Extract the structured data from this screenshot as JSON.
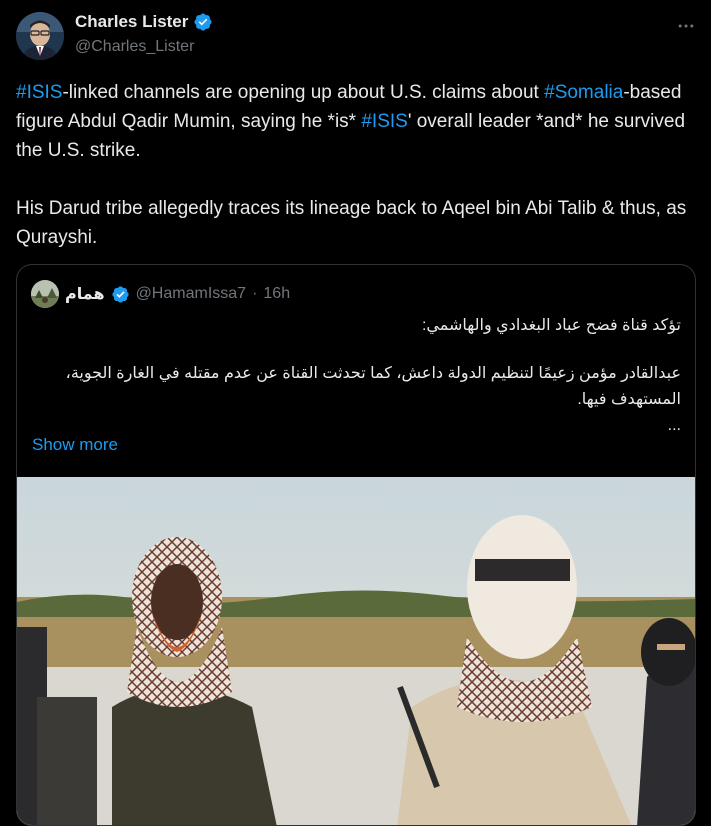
{
  "colors": {
    "background": "#000000",
    "text": "#e7e9ea",
    "muted": "#71767b",
    "link": "#1d9bf0",
    "verified": "#1d9bf0",
    "border": "#2f3336"
  },
  "author": {
    "name": "Charles Lister",
    "handle": "@Charles_Lister",
    "verified_icon": "verified-badge-icon"
  },
  "more_icon": "more-horizontal-icon",
  "tweet": {
    "p1": {
      "h1": "#ISIS",
      "t1": "-linked channels are opening up about U.S. claims about ",
      "h2": "#Somalia",
      "t2": "-based figure Abdul Qadir Mumin, saying he *is* ",
      "h3": "#ISIS",
      "t3": "' overall leader *and* he survived the U.S. strike."
    },
    "p2": "His Darud tribe allegedly traces its lineage back to Aqeel bin Abi Talib & thus, as Qurayshi."
  },
  "quote": {
    "name": "همام",
    "handle": "@HamamIssa7",
    "separator": "·",
    "time": "16h",
    "line1": "تؤكد قناة فضح عباد البغدادي والهاشمي:",
    "line2": "عبدالقادر مؤمن زعيمًا لتنظيم الدولة داعش، كما تحدثت القناة عن عدم مقتله في الغارة الجوية، المستهدف فيها.",
    "ellipsis": "...",
    "show_more": "Show more"
  }
}
